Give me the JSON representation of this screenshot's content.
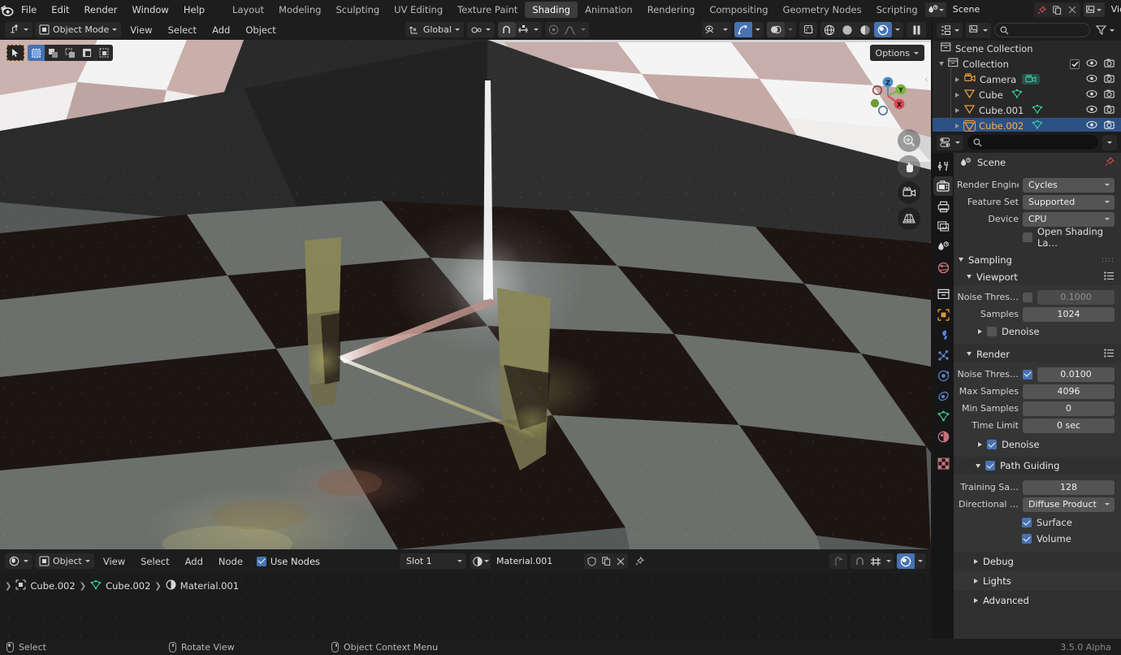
{
  "app": {
    "version": "3.5.0 Alpha"
  },
  "topbar": {
    "menus": [
      "File",
      "Edit",
      "Render",
      "Window",
      "Help"
    ],
    "workspaces": [
      "Layout",
      "Modeling",
      "Sculpting",
      "UV Editing",
      "Texture Paint",
      "Shading",
      "Animation",
      "Rendering",
      "Compositing",
      "Geometry Nodes",
      "Scripting"
    ],
    "active_workspace": "Shading",
    "scene_name": "Scene",
    "viewlayer_name": "ViewLayer"
  },
  "viewport_header": {
    "mode": "Object Mode",
    "menus": [
      "View",
      "Select",
      "Add",
      "Object"
    ],
    "transform_orientation": "Global",
    "options_label": "Options"
  },
  "viewport": {
    "gizmo_axes": [
      "X",
      "Y",
      "Z"
    ]
  },
  "outliner": {
    "rows": [
      {
        "label": "Scene Collection",
        "indent": 0,
        "icon": "collection-icon",
        "selected": false,
        "expander": "none",
        "has_toggles": false
      },
      {
        "label": "Collection",
        "indent": 1,
        "icon": "collection-icon",
        "selected": false,
        "expander": "down",
        "has_toggles": true,
        "checkbox": true
      },
      {
        "label": "Camera",
        "indent": 2,
        "icon": "camera-object-icon",
        "selected": false,
        "expander": "right",
        "has_toggles": true,
        "data_icon": "camera-data-icon"
      },
      {
        "label": "Cube",
        "indent": 2,
        "icon": "mesh-object-icon",
        "selected": false,
        "expander": "right",
        "has_toggles": true,
        "data_icon": "mesh-data-icon"
      },
      {
        "label": "Cube.001",
        "indent": 2,
        "icon": "mesh-object-icon",
        "selected": false,
        "expander": "right",
        "has_toggles": true,
        "data_icon": "mesh-data-icon"
      },
      {
        "label": "Cube.002",
        "indent": 2,
        "icon": "mesh-object-icon",
        "selected": true,
        "expander": "right",
        "has_toggles": true,
        "data_icon": "mesh-data-icon"
      }
    ]
  },
  "properties": {
    "context_name": "Scene",
    "render_engine_label": "Render Engine",
    "render_engine_value": "Cycles",
    "feature_set_label": "Feature Set",
    "feature_set_value": "Supported",
    "device_label": "Device",
    "device_value": "CPU",
    "osl_label": "Open Shading La…",
    "osl_checked": false,
    "sampling_panel": "Sampling",
    "viewport_panel": "Viewport",
    "viewport_noise_label": "Noise Thres…",
    "viewport_noise_value": "0.1000",
    "viewport_noise_checked": false,
    "viewport_samples_label": "Samples",
    "viewport_samples_value": "1024",
    "viewport_denoise_label": "Denoise",
    "viewport_denoise_checked": false,
    "render_panel": "Render",
    "render_noise_label": "Noise Thres…",
    "render_noise_value": "0.0100",
    "render_noise_checked": true,
    "max_samples_label": "Max Samples",
    "max_samples_value": "4096",
    "min_samples_label": "Min Samples",
    "min_samples_value": "0",
    "time_limit_label": "Time Limit",
    "time_limit_value": "0 sec",
    "render_denoise_label": "Denoise",
    "render_denoise_checked": true,
    "path_guiding_label": "Path Guiding",
    "path_guiding_checked": true,
    "training_samples_label": "Training Sa…",
    "training_samples_value": "128",
    "directional_label": "Directional …",
    "directional_value": "Diffuse Product",
    "surface_label": "Surface",
    "surface_checked": true,
    "volume_label": "Volume",
    "volume_checked": true,
    "debug_panel": "Debug",
    "lights_panel": "Lights",
    "advanced_panel": "Advanced"
  },
  "shader_editor": {
    "shader_type": "Object",
    "menus": [
      "View",
      "Select",
      "Add",
      "Node"
    ],
    "use_nodes_label": "Use Nodes",
    "use_nodes_checked": true,
    "slot_value": "Slot 1",
    "material_name": "Material.001",
    "breadcrumb": [
      "Cube.002",
      "Cube.002",
      "Material.001"
    ]
  },
  "statusbar": {
    "items": [
      {
        "label": "Select",
        "mouse": "left"
      },
      {
        "label": "Rotate View",
        "mouse": "middle"
      },
      {
        "label": "Object Context Menu",
        "mouse": "right"
      }
    ]
  },
  "colors": {
    "accent_blue": "#4772b3",
    "select_orange": "#e09a3a",
    "panel_bg": "#303030",
    "header_bg": "#1d1d1d",
    "field_bg": "#545454"
  }
}
